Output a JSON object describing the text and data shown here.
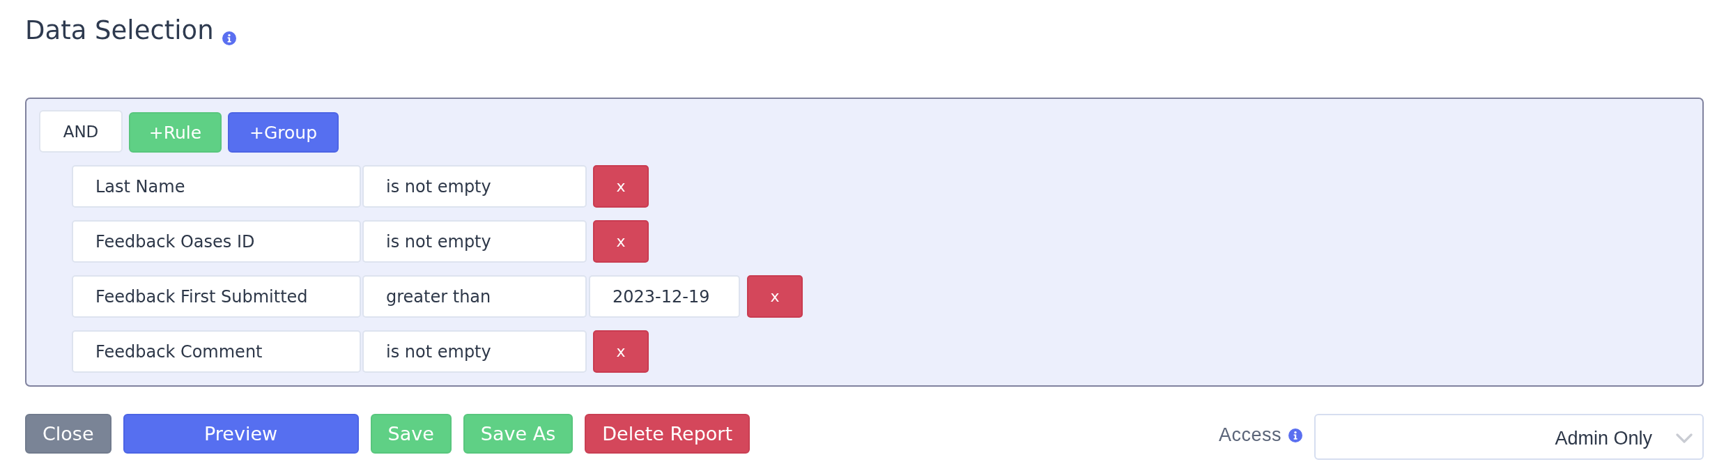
{
  "title": "Data Selection",
  "query": {
    "conjunction": "AND",
    "add_rule": "+Rule",
    "add_group": "+Group",
    "rules": [
      {
        "field": "Last Name",
        "operator": "is not empty",
        "remove": "x"
      },
      {
        "field": "Feedback Oases ID",
        "operator": "is not empty",
        "remove": "x"
      },
      {
        "field": "Feedback First Submitted",
        "operator": "greater than",
        "value": "2023-12-19",
        "remove": "x"
      },
      {
        "field": "Feedback Comment",
        "operator": "is not empty",
        "remove": "x"
      }
    ]
  },
  "actions": [
    {
      "label": "Close",
      "kind": "secondary"
    },
    {
      "label": "Preview",
      "kind": "primary"
    },
    {
      "label": "Save",
      "kind": "success"
    },
    {
      "label": "Save As",
      "kind": "success"
    },
    {
      "label": "Delete Report",
      "kind": "danger"
    }
  ],
  "access": {
    "label": "Access",
    "value": "Admin Only"
  }
}
